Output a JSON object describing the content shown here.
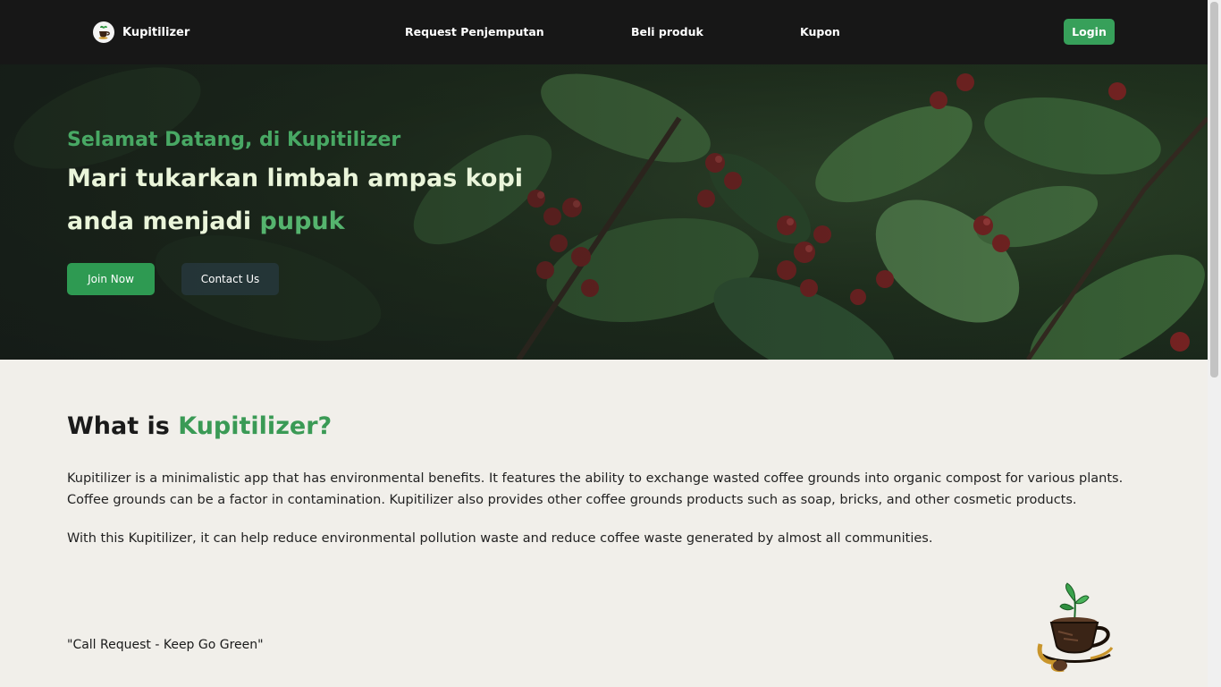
{
  "nav": {
    "brand": "Kupitilizer",
    "links": [
      "Request Penjemputan",
      "Beli produk",
      "Kupon"
    ],
    "login": "Login"
  },
  "hero": {
    "welcome": "Selamat Datang, di Kupitilizer",
    "line1": "Mari tukarkan limbah ampas kopi",
    "line2_prefix": "anda menjadi ",
    "line2_highlight": "pupuk",
    "join_button": "Join Now",
    "contact_button": "Contact Us"
  },
  "about": {
    "title_prefix": "What is ",
    "title_highlight": "Kupitilizer?",
    "paragraph1": "Kupitilizer is a minimalistic app that has environmental benefits. It features the ability to exchange wasted coffee grounds into organic compost for various plants. Coffee grounds can be a factor in contamination. Kupitilizer also provides other coffee grounds products such as soap, bricks, and other cosmetic products.",
    "paragraph2": "With this Kupitilizer, it can help reduce environmental pollution waste and reduce coffee waste generated by almost all communities.",
    "tagline": "\"Call Request - Keep Go Green\""
  },
  "colors": {
    "nav_bg": "#171717",
    "accent_green": "#37a05a",
    "hero_text": "#eaf5da",
    "page_bg": "#f1efea"
  }
}
